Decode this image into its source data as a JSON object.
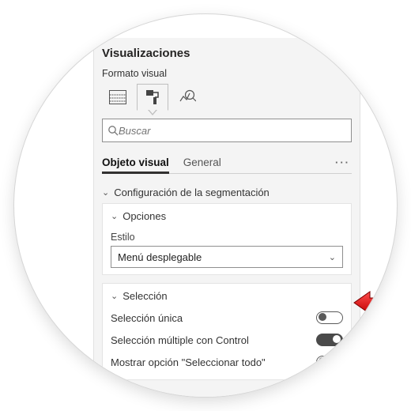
{
  "panel": {
    "title": "Visualizaciones",
    "subtitle": "Formato visual"
  },
  "search": {
    "placeholder": "Buscar"
  },
  "tabs": {
    "visual": "Objeto visual",
    "general": "General"
  },
  "group_config": {
    "label": "Configuración de la segmentación"
  },
  "opciones": {
    "header": "Opciones",
    "estilo_label": "Estilo",
    "estilo_value": "Menú desplegable"
  },
  "seleccion": {
    "header": "Selección",
    "unica": "Selección única",
    "multiple": "Selección múltiple con Control",
    "todo": "Mostrar opción \"Seleccionar todo\""
  },
  "toggles": {
    "unica": false,
    "multiple": true,
    "todo": false
  }
}
